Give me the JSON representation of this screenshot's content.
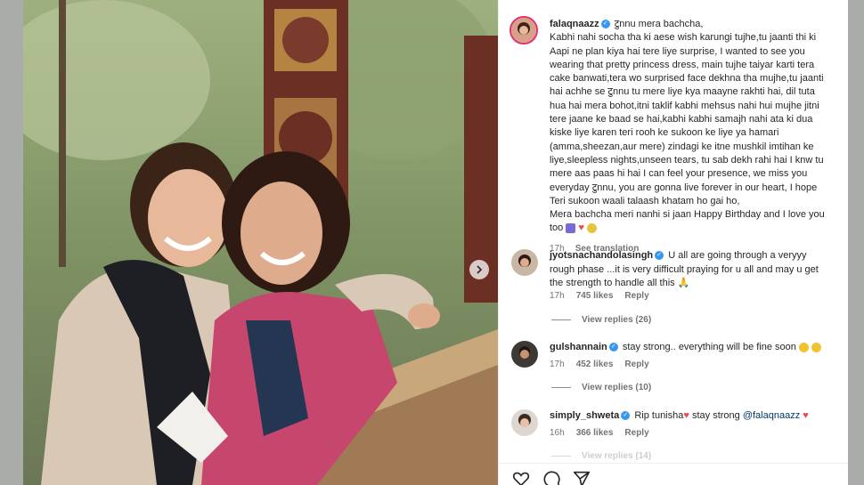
{
  "post": {
    "username": "falaqnaazz",
    "caption_lines": [
      "टुnnu mera bachcha,",
      "Kabhi nahi socha tha ki aese wish karungi tujhe,tu jaanti thi ki",
      "Aapi ne plan kiya hai tere liye surprise, I wanted to see you",
      "wearing that pretty princess dress, main tujhe taiyar karti tera",
      "cake banwati,tera wo surprised face dekhna tha mujhe,tu jaanti",
      "hai achhe se टुnnu tu mere liye kya maayne rakhti hai, dil tuta",
      "hua hai mera bohot,itni taklif kabhi mehsus nahi hui mujhe jitni",
      "tere jaane ke baad se hai,kabhi kabhi samajh nahi ata ki dua",
      "kiske liye karen teri rooh ke sukoon ke liye ya hamari",
      "(amma,sheezan,aur mere) zindagi ke itne mushkil imtihan ke",
      "liye,sleepless nights,unseen tears, tu sab dekh rahi hai I knw tu",
      "mere aas paas hi hai I can feel your presence, we miss you",
      "everyday टुnnu, you are gonna live forever in our heart, I hope",
      "Teri sukoon waali talaash khatam ho gai ho,",
      "Mera bachcha meri nanhi si jaan Happy Birthday and I love you",
      "too"
    ],
    "time": "17h",
    "see_translation": "See translation"
  },
  "comments": [
    {
      "username": "jyotsnachandolasingh",
      "text_lines": [
        "U all are going through a veryyy",
        "rough phase ...it is very difficult praying for u all and may u get",
        "the strength to handle all this"
      ],
      "time": "17h",
      "likes": "745 likes",
      "reply": "Reply",
      "view_replies": "View replies (26)"
    },
    {
      "username": "gulshannain",
      "text_lines": [
        "stay strong.. everything will be fine soon"
      ],
      "time": "17h",
      "likes": "452 likes",
      "reply": "Reply",
      "view_replies": "View replies (10)"
    },
    {
      "username": "simply_shweta",
      "text_a": "Rip tunisha",
      "text_b": " stay strong ",
      "mention": "@falaqnaazz",
      "time": "16h",
      "likes": "366 likes",
      "reply": "Reply",
      "view_replies": "View replies (14)"
    }
  ],
  "icons": [
    "heart-icon",
    "comment-icon",
    "share-icon",
    "next-arrow-icon",
    "verified-icon"
  ],
  "colors": {
    "accent": "#e1306c",
    "verified": "#3897f0",
    "mention": "#00376b",
    "heart_red": "#ed4956"
  }
}
